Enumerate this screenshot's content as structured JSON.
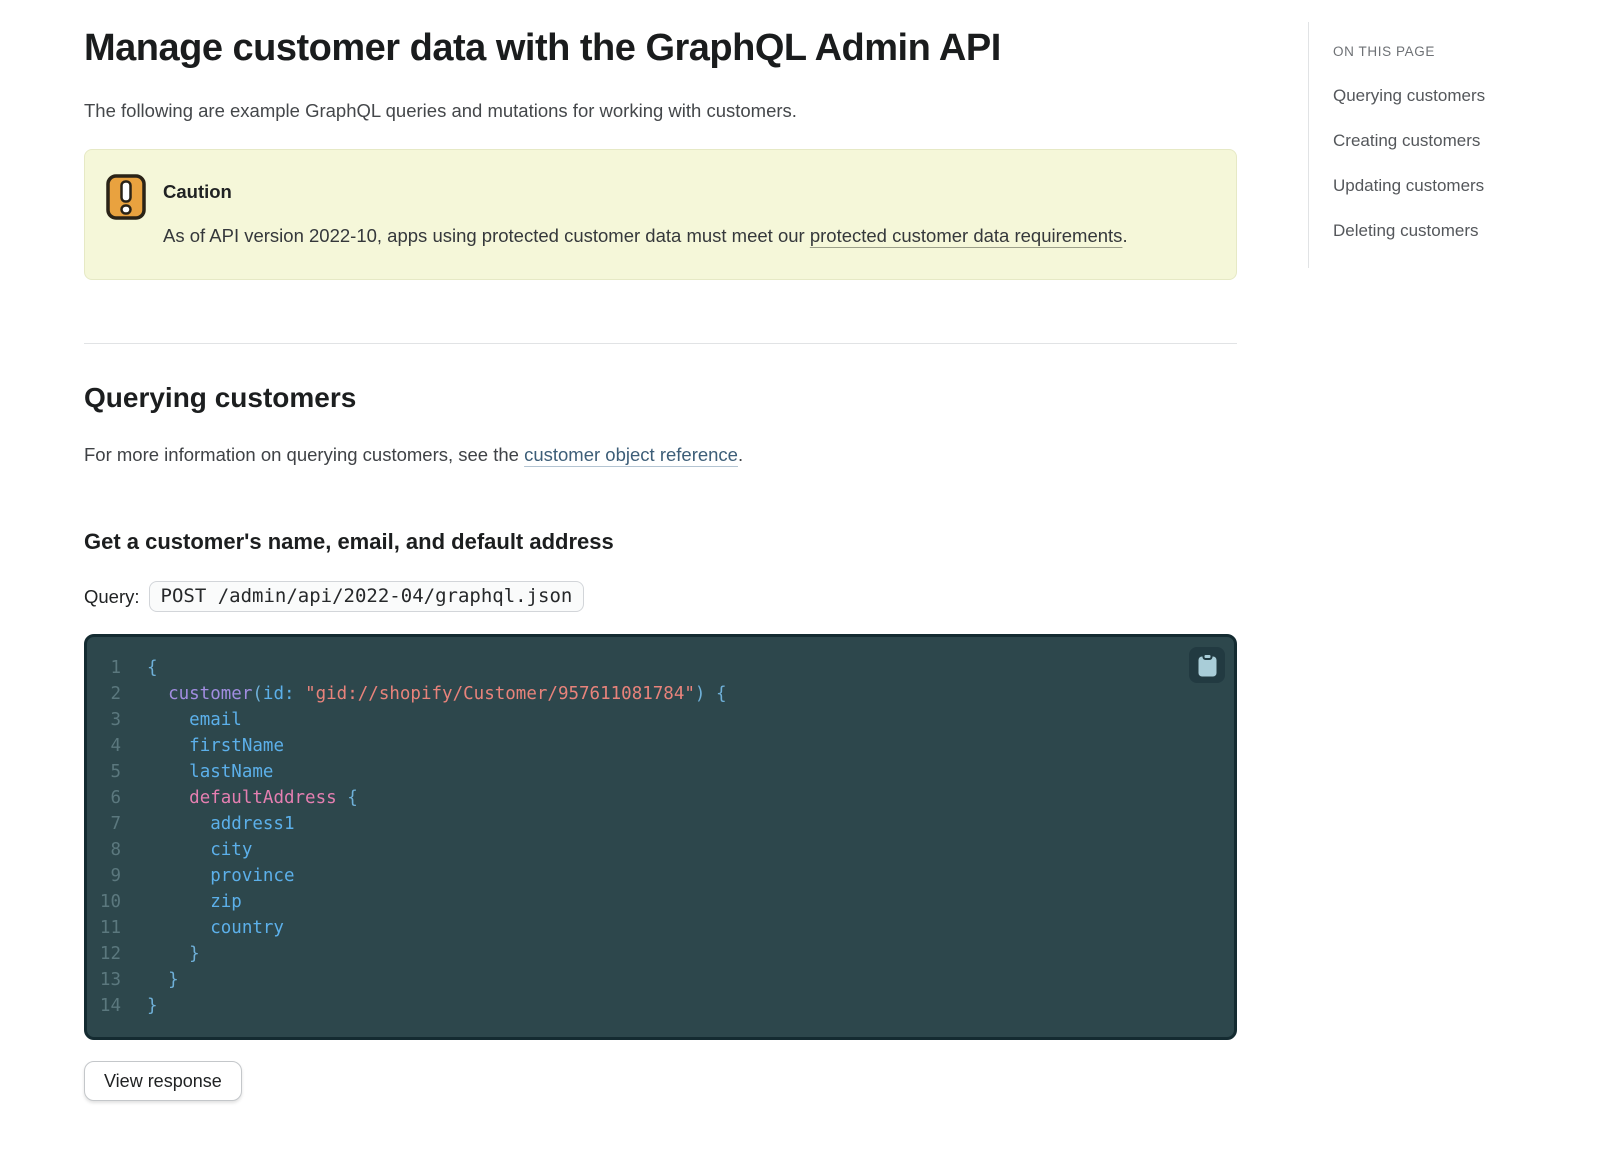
{
  "page": {
    "title": "Manage customer data with the GraphQL Admin API",
    "subtitle": "The following are example GraphQL queries and mutations for working with customers."
  },
  "notice": {
    "icon": "warning-icon",
    "title": "Caution",
    "text_before": "As of API version 2022-10, apps using protected customer data must meet our ",
    "link_label": "protected customer data requirements",
    "text_after": "."
  },
  "sidebar": {
    "heading": "ON THIS PAGE",
    "items": [
      {
        "label": "Querying customers"
      },
      {
        "label": "Creating customers"
      },
      {
        "label": "Updating customers"
      },
      {
        "label": "Deleting customers"
      }
    ]
  },
  "section": {
    "heading": "Querying customers",
    "intro_before": "For more information on querying customers, see the ",
    "intro_link": "customer object reference",
    "intro_after": "."
  },
  "example": {
    "heading": "Get a customer's name, email, and default address",
    "query_label": "Query:",
    "endpoint": "POST /admin/api/2022-04/graphql.json",
    "copy_icon": "clipboard-icon",
    "view_response_label": "View response"
  },
  "code": {
    "language": "graphql",
    "lines": [
      {
        "n": "1",
        "tokens": [
          {
            "t": "{",
            "c": "pun"
          }
        ]
      },
      {
        "n": "2",
        "tokens": [
          {
            "t": "  "
          },
          {
            "t": "customer",
            "c": "fn"
          },
          {
            "t": "(",
            "c": "pun"
          },
          {
            "t": "id:",
            "c": "fld"
          },
          {
            "t": " "
          },
          {
            "t": "\"gid://shopify/Customer/957611081784\"",
            "c": "str"
          },
          {
            "t": ") {",
            "c": "pun"
          }
        ]
      },
      {
        "n": "3",
        "tokens": [
          {
            "t": "    "
          },
          {
            "t": "email",
            "c": "fld"
          }
        ]
      },
      {
        "n": "4",
        "tokens": [
          {
            "t": "    "
          },
          {
            "t": "firstName",
            "c": "fld"
          }
        ]
      },
      {
        "n": "5",
        "tokens": [
          {
            "t": "    "
          },
          {
            "t": "lastName",
            "c": "fld"
          }
        ]
      },
      {
        "n": "6",
        "tokens": [
          {
            "t": "    "
          },
          {
            "t": "defaultAddress",
            "c": "obj"
          },
          {
            "t": " "
          },
          {
            "t": "{",
            "c": "pun"
          }
        ]
      },
      {
        "n": "7",
        "tokens": [
          {
            "t": "      "
          },
          {
            "t": "address1",
            "c": "fld"
          }
        ]
      },
      {
        "n": "8",
        "tokens": [
          {
            "t": "      "
          },
          {
            "t": "city",
            "c": "fld"
          }
        ]
      },
      {
        "n": "9",
        "tokens": [
          {
            "t": "      "
          },
          {
            "t": "province",
            "c": "fld"
          }
        ]
      },
      {
        "n": "10",
        "tokens": [
          {
            "t": "      "
          },
          {
            "t": "zip",
            "c": "fld"
          }
        ]
      },
      {
        "n": "11",
        "tokens": [
          {
            "t": "      "
          },
          {
            "t": "country",
            "c": "fld"
          }
        ]
      },
      {
        "n": "12",
        "tokens": [
          {
            "t": "    "
          },
          {
            "t": "}",
            "c": "pun"
          }
        ]
      },
      {
        "n": "13",
        "tokens": [
          {
            "t": "  "
          },
          {
            "t": "}",
            "c": "pun"
          }
        ]
      },
      {
        "n": "14",
        "tokens": [
          {
            "t": "}",
            "c": "pun"
          }
        ]
      }
    ]
  },
  "colors": {
    "text_primary": "#202223",
    "text_secondary": "#44474a",
    "divider": "#e1e3e5",
    "link_blue": "#3d5e78",
    "caution_bg": "#f5f7d9",
    "caution_border": "#e6e9c5",
    "caution_icon_fill": "#e9a23f",
    "caution_icon_border": "#2a2317",
    "code_bg": "#2d474c",
    "code_border": "#142b31",
    "code_line_number": "#5b787e",
    "tok_pun": "#6fb0d8",
    "tok_fld": "#5cb0ea",
    "tok_fn": "#a18de0",
    "tok_str": "#e8837b",
    "tok_obj": "#e57fb1",
    "copy_button_bg": "#223a41",
    "copy_icon": "#a9cdd8"
  }
}
